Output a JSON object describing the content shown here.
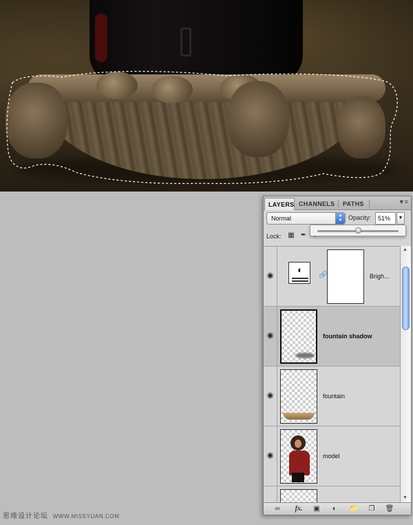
{
  "layers_panel": {
    "tabs": [
      {
        "label": "LAYERS",
        "active": true
      },
      {
        "label": "CHANNELS",
        "active": false
      },
      {
        "label": "PATHS",
        "active": false
      }
    ],
    "panel_menu_icon": "panel-menu-icon",
    "blend_mode": "Normal",
    "opacity_label": "Opacity:",
    "opacity_value": "51%",
    "opacity_fraction": 0.51,
    "lock_label": "Lock:",
    "layers": [
      {
        "name": "Brigh...",
        "type": "adjustment",
        "visible": true,
        "selected": false
      },
      {
        "name": "fountain shadow",
        "type": "pixel",
        "visible": true,
        "selected": true
      },
      {
        "name": "fountain",
        "type": "pixel",
        "visible": true,
        "selected": false
      },
      {
        "name": "model",
        "type": "pixel",
        "visible": true,
        "selected": false
      },
      {
        "name": "",
        "type": "pixel",
        "visible": false,
        "selected": false
      }
    ],
    "bottom_tools": [
      "link-icon",
      "fx-icon",
      "mask-icon",
      "adjustment-icon",
      "folder-icon",
      "new-layer-icon",
      "trash-icon"
    ],
    "fx_label": "fx."
  },
  "canvas": {
    "description_icons": [
      "fountain-image"
    ]
  },
  "watermark": {
    "cn": "思缘设计论坛",
    "url": "WWW.MISSYUAN.COM"
  },
  "colors": {
    "selected_row": "#c2c2c2",
    "scroll_thumb": "#8fb4e8",
    "workspace": "#bdbdbd"
  }
}
